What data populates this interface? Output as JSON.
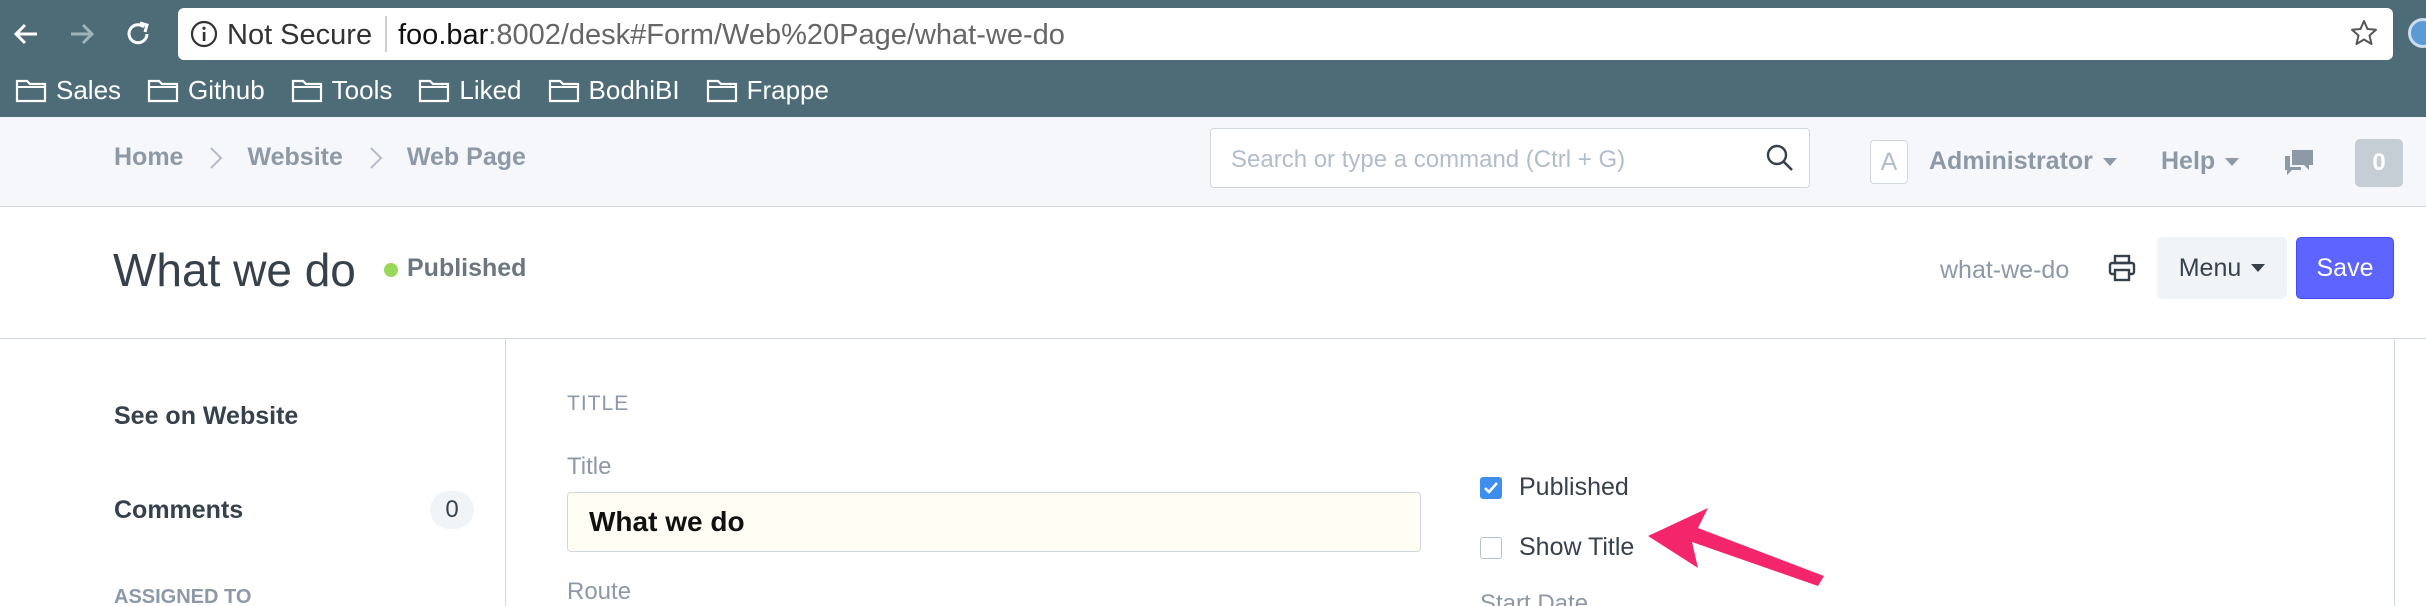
{
  "browser": {
    "security_label": "Not Secure",
    "url_host": "foo.bar",
    "url_rest": ":8002/desk#Form/Web%20Page/what-we-do",
    "bookmarks": [
      "Sales",
      "Github",
      "Tools",
      "Liked",
      "BodhiBI",
      "Frappe"
    ]
  },
  "navbar": {
    "breadcrumbs": [
      "Home",
      "Website",
      "Web Page"
    ],
    "search_placeholder": "Search or type a command (Ctrl + G)",
    "avatar_letter": "A",
    "user_name": "Administrator",
    "help_label": "Help",
    "notification_count": "0"
  },
  "page_head": {
    "title": "What we do",
    "status": "Published",
    "status_color": "#98d85b",
    "doc_name": "what-we-do",
    "menu_label": "Menu",
    "save_label": "Save",
    "save_color": "#5e64ff"
  },
  "sidebar": {
    "see_on_website": "See on Website",
    "comments_label": "Comments",
    "comments_count": "0",
    "assigned_to": "ASSIGNED TO"
  },
  "form": {
    "section_title": "TITLE",
    "title_label": "Title",
    "title_value": "What we do",
    "route_label": "Route",
    "published_label": "Published",
    "published_checked": true,
    "show_title_label": "Show Title",
    "show_title_checked": false,
    "start_date_label": "Start Date",
    "arrow_color": "#f3266b"
  }
}
